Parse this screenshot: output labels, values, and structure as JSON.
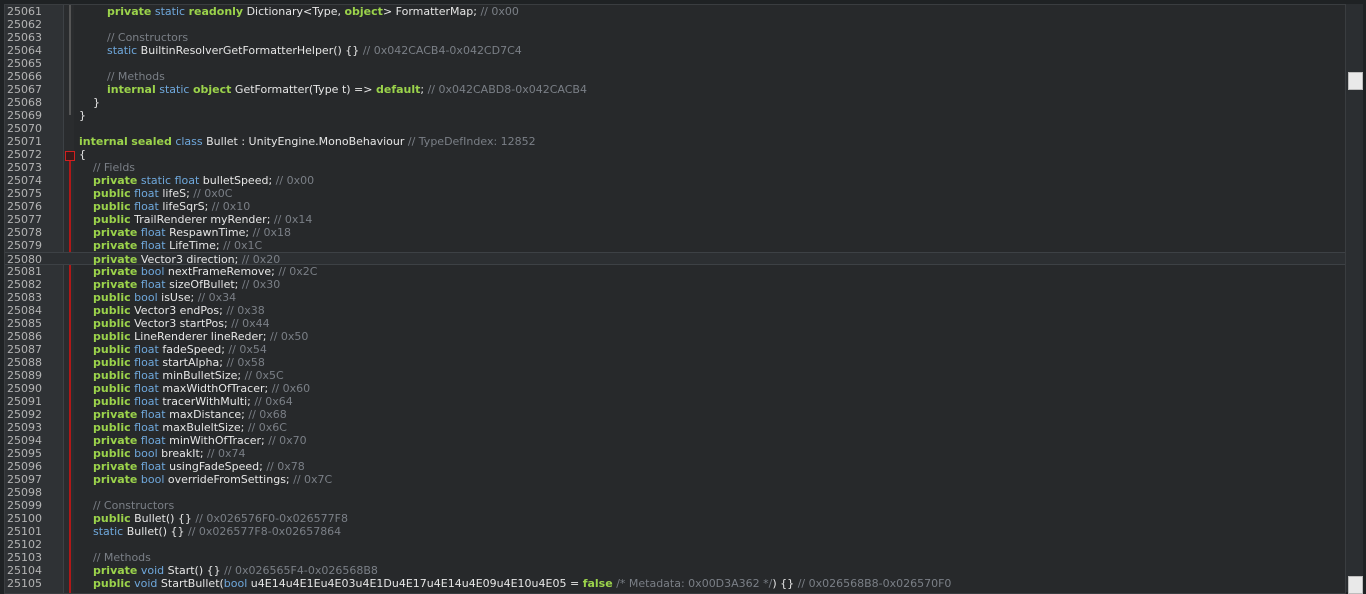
{
  "editor": {
    "lines": [
      {
        "n": "25061",
        "segs": [
          [
            "        ",
            "txt"
          ],
          [
            "private",
            "kw"
          ],
          [
            " ",
            "txt"
          ],
          [
            "static",
            "type"
          ],
          [
            " ",
            "txt"
          ],
          [
            "readonly",
            "kw"
          ],
          [
            " Dictionary<Type, ",
            "txt"
          ],
          [
            "object",
            "kw"
          ],
          [
            "> FormatterMap; ",
            "txt"
          ],
          [
            "// 0x00",
            "cm"
          ]
        ]
      },
      {
        "n": "25062",
        "segs": []
      },
      {
        "n": "25063",
        "segs": [
          [
            "        ",
            "txt"
          ],
          [
            "// Constructors",
            "cm"
          ]
        ]
      },
      {
        "n": "25064",
        "segs": [
          [
            "        ",
            "txt"
          ],
          [
            "static",
            "type"
          ],
          [
            " BuiltinResolverGetFormatterHelper() {} ",
            "txt"
          ],
          [
            "// 0x042CACB4-0x042CD7C4",
            "cm"
          ]
        ]
      },
      {
        "n": "25065",
        "segs": []
      },
      {
        "n": "25066",
        "segs": [
          [
            "        ",
            "txt"
          ],
          [
            "// Methods",
            "cm"
          ]
        ]
      },
      {
        "n": "25067",
        "segs": [
          [
            "        ",
            "txt"
          ],
          [
            "internal",
            "kw"
          ],
          [
            " ",
            "txt"
          ],
          [
            "static",
            "type"
          ],
          [
            " ",
            "txt"
          ],
          [
            "object",
            "kw"
          ],
          [
            " GetFormatter(Type t) => ",
            "txt"
          ],
          [
            "default",
            "kw"
          ],
          [
            "; ",
            "txt"
          ],
          [
            "// 0x042CABD8-0x042CACB4",
            "cm"
          ]
        ]
      },
      {
        "n": "25068",
        "segs": [
          [
            "    }",
            "txt"
          ]
        ]
      },
      {
        "n": "25069",
        "segs": [
          [
            "}",
            "txt"
          ]
        ]
      },
      {
        "n": "25070",
        "segs": []
      },
      {
        "n": "25071",
        "segs": [
          [
            "internal",
            "kw"
          ],
          [
            " ",
            "txt"
          ],
          [
            "sealed",
            "kw"
          ],
          [
            " ",
            "txt"
          ],
          [
            "class",
            "type"
          ],
          [
            " Bullet : UnityEngine.MonoBehaviour ",
            "txt"
          ],
          [
            "// TypeDefIndex: 12852",
            "cm"
          ]
        ]
      },
      {
        "n": "25072",
        "segs": [
          [
            "{",
            "txt"
          ]
        ]
      },
      {
        "n": "25073",
        "segs": [
          [
            "    ",
            "txt"
          ],
          [
            "// Fields",
            "cm"
          ]
        ]
      },
      {
        "n": "25074",
        "segs": [
          [
            "    ",
            "txt"
          ],
          [
            "private",
            "kw"
          ],
          [
            " ",
            "txt"
          ],
          [
            "static",
            "type"
          ],
          [
            " ",
            "txt"
          ],
          [
            "float",
            "type"
          ],
          [
            " bulletSpeed; ",
            "txt"
          ],
          [
            "// 0x00",
            "cm"
          ]
        ]
      },
      {
        "n": "25075",
        "segs": [
          [
            "    ",
            "txt"
          ],
          [
            "public",
            "kw"
          ],
          [
            " ",
            "txt"
          ],
          [
            "float",
            "type"
          ],
          [
            " lifeS; ",
            "txt"
          ],
          [
            "// 0x0C",
            "cm"
          ]
        ]
      },
      {
        "n": "25076",
        "segs": [
          [
            "    ",
            "txt"
          ],
          [
            "public",
            "kw"
          ],
          [
            " ",
            "txt"
          ],
          [
            "float",
            "type"
          ],
          [
            " lifeSqrS; ",
            "txt"
          ],
          [
            "// 0x10",
            "cm"
          ]
        ]
      },
      {
        "n": "25077",
        "segs": [
          [
            "    ",
            "txt"
          ],
          [
            "public",
            "kw"
          ],
          [
            " TrailRenderer myRender; ",
            "txt"
          ],
          [
            "// 0x14",
            "cm"
          ]
        ]
      },
      {
        "n": "25078",
        "segs": [
          [
            "    ",
            "txt"
          ],
          [
            "private",
            "kw"
          ],
          [
            " ",
            "txt"
          ],
          [
            "float",
            "type"
          ],
          [
            " RespawnTime; ",
            "txt"
          ],
          [
            "// 0x18",
            "cm"
          ]
        ]
      },
      {
        "n": "25079",
        "segs": [
          [
            "    ",
            "txt"
          ],
          [
            "private",
            "kw"
          ],
          [
            " ",
            "txt"
          ],
          [
            "float",
            "type"
          ],
          [
            " LifeTime; ",
            "txt"
          ],
          [
            "// 0x1C",
            "cm"
          ]
        ]
      },
      {
        "n": "25080",
        "current": true,
        "segs": [
          [
            "    ",
            "txt"
          ],
          [
            "private",
            "kw"
          ],
          [
            " Vector3 direction; ",
            "txt"
          ],
          [
            "// 0x20",
            "cm"
          ]
        ]
      },
      {
        "n": "25081",
        "segs": [
          [
            "    ",
            "txt"
          ],
          [
            "private",
            "kw"
          ],
          [
            " ",
            "txt"
          ],
          [
            "bool",
            "type"
          ],
          [
            " nextFrameRemove; ",
            "txt"
          ],
          [
            "// 0x2C",
            "cm"
          ]
        ]
      },
      {
        "n": "25082",
        "segs": [
          [
            "    ",
            "txt"
          ],
          [
            "private",
            "kw"
          ],
          [
            " ",
            "txt"
          ],
          [
            "float",
            "type"
          ],
          [
            " sizeOfBullet; ",
            "txt"
          ],
          [
            "// 0x30",
            "cm"
          ]
        ]
      },
      {
        "n": "25083",
        "segs": [
          [
            "    ",
            "txt"
          ],
          [
            "public",
            "kw"
          ],
          [
            " ",
            "txt"
          ],
          [
            "bool",
            "type"
          ],
          [
            " isUse; ",
            "txt"
          ],
          [
            "// 0x34",
            "cm"
          ]
        ]
      },
      {
        "n": "25084",
        "segs": [
          [
            "    ",
            "txt"
          ],
          [
            "public",
            "kw"
          ],
          [
            " Vector3 endPos; ",
            "txt"
          ],
          [
            "// 0x38",
            "cm"
          ]
        ]
      },
      {
        "n": "25085",
        "segs": [
          [
            "    ",
            "txt"
          ],
          [
            "public",
            "kw"
          ],
          [
            " Vector3 startPos; ",
            "txt"
          ],
          [
            "// 0x44",
            "cm"
          ]
        ]
      },
      {
        "n": "25086",
        "segs": [
          [
            "    ",
            "txt"
          ],
          [
            "public",
            "kw"
          ],
          [
            " LineRenderer lineReder; ",
            "txt"
          ],
          [
            "// 0x50",
            "cm"
          ]
        ]
      },
      {
        "n": "25087",
        "segs": [
          [
            "    ",
            "txt"
          ],
          [
            "public",
            "kw"
          ],
          [
            " ",
            "txt"
          ],
          [
            "float",
            "type"
          ],
          [
            " fadeSpeed; ",
            "txt"
          ],
          [
            "// 0x54",
            "cm"
          ]
        ]
      },
      {
        "n": "25088",
        "segs": [
          [
            "    ",
            "txt"
          ],
          [
            "public",
            "kw"
          ],
          [
            " ",
            "txt"
          ],
          [
            "float",
            "type"
          ],
          [
            " startAlpha; ",
            "txt"
          ],
          [
            "// 0x58",
            "cm"
          ]
        ]
      },
      {
        "n": "25089",
        "segs": [
          [
            "    ",
            "txt"
          ],
          [
            "public",
            "kw"
          ],
          [
            " ",
            "txt"
          ],
          [
            "float",
            "type"
          ],
          [
            " minBulletSize; ",
            "txt"
          ],
          [
            "// 0x5C",
            "cm"
          ]
        ]
      },
      {
        "n": "25090",
        "segs": [
          [
            "    ",
            "txt"
          ],
          [
            "public",
            "kw"
          ],
          [
            " ",
            "txt"
          ],
          [
            "float",
            "type"
          ],
          [
            " maxWidthOfTracer; ",
            "txt"
          ],
          [
            "// 0x60",
            "cm"
          ]
        ]
      },
      {
        "n": "25091",
        "segs": [
          [
            "    ",
            "txt"
          ],
          [
            "public",
            "kw"
          ],
          [
            " ",
            "txt"
          ],
          [
            "float",
            "type"
          ],
          [
            " tracerWithMulti; ",
            "txt"
          ],
          [
            "// 0x64",
            "cm"
          ]
        ]
      },
      {
        "n": "25092",
        "segs": [
          [
            "    ",
            "txt"
          ],
          [
            "private",
            "kw"
          ],
          [
            " ",
            "txt"
          ],
          [
            "float",
            "type"
          ],
          [
            " maxDistance; ",
            "txt"
          ],
          [
            "// 0x68",
            "cm"
          ]
        ]
      },
      {
        "n": "25093",
        "segs": [
          [
            "    ",
            "txt"
          ],
          [
            "public",
            "kw"
          ],
          [
            " ",
            "txt"
          ],
          [
            "float",
            "type"
          ],
          [
            " maxBuleltSize; ",
            "txt"
          ],
          [
            "// 0x6C",
            "cm"
          ]
        ]
      },
      {
        "n": "25094",
        "segs": [
          [
            "    ",
            "txt"
          ],
          [
            "private",
            "kw"
          ],
          [
            " ",
            "txt"
          ],
          [
            "float",
            "type"
          ],
          [
            " minWithOfTracer; ",
            "txt"
          ],
          [
            "// 0x70",
            "cm"
          ]
        ]
      },
      {
        "n": "25095",
        "segs": [
          [
            "    ",
            "txt"
          ],
          [
            "public",
            "kw"
          ],
          [
            " ",
            "txt"
          ],
          [
            "bool",
            "type"
          ],
          [
            " breakIt; ",
            "txt"
          ],
          [
            "// 0x74",
            "cm"
          ]
        ]
      },
      {
        "n": "25096",
        "segs": [
          [
            "    ",
            "txt"
          ],
          [
            "private",
            "kw"
          ],
          [
            " ",
            "txt"
          ],
          [
            "float",
            "type"
          ],
          [
            " usingFadeSpeed; ",
            "txt"
          ],
          [
            "// 0x78",
            "cm"
          ]
        ]
      },
      {
        "n": "25097",
        "segs": [
          [
            "    ",
            "txt"
          ],
          [
            "private",
            "kw"
          ],
          [
            " ",
            "txt"
          ],
          [
            "bool",
            "type"
          ],
          [
            " overrideFromSettings; ",
            "txt"
          ],
          [
            "// 0x7C",
            "cm"
          ]
        ]
      },
      {
        "n": "25098",
        "segs": []
      },
      {
        "n": "25099",
        "segs": [
          [
            "    ",
            "txt"
          ],
          [
            "// Constructors",
            "cm"
          ]
        ]
      },
      {
        "n": "25100",
        "segs": [
          [
            "    ",
            "txt"
          ],
          [
            "public",
            "kw"
          ],
          [
            " Bullet() {} ",
            "txt"
          ],
          [
            "// 0x026576F0-0x026577F8",
            "cm"
          ]
        ]
      },
      {
        "n": "25101",
        "segs": [
          [
            "    ",
            "txt"
          ],
          [
            "static",
            "type"
          ],
          [
            " Bullet() {} ",
            "txt"
          ],
          [
            "// 0x026577F8-0x02657864",
            "cm"
          ]
        ]
      },
      {
        "n": "25102",
        "segs": []
      },
      {
        "n": "25103",
        "segs": [
          [
            "    ",
            "txt"
          ],
          [
            "// Methods",
            "cm"
          ]
        ]
      },
      {
        "n": "25104",
        "segs": [
          [
            "    ",
            "txt"
          ],
          [
            "private",
            "kw"
          ],
          [
            " ",
            "txt"
          ],
          [
            "void",
            "type"
          ],
          [
            " Start() {} ",
            "txt"
          ],
          [
            "// 0x026565F4-0x026568B8",
            "cm"
          ]
        ]
      },
      {
        "n": "25105",
        "segs": [
          [
            "    ",
            "txt"
          ],
          [
            "public",
            "kw"
          ],
          [
            " ",
            "txt"
          ],
          [
            "void",
            "type"
          ],
          [
            " StartBullet(",
            "txt"
          ],
          [
            "bool",
            "type"
          ],
          [
            " u4E14u4E1Eu4E03u4E1Du4E17u4E14u4E09u4E10u4E05 = ",
            "txt"
          ],
          [
            "false",
            "kw"
          ],
          [
            " ",
            "txt"
          ],
          [
            "/* Metadata: 0x00D3A362 */",
            "cm"
          ],
          [
            ") {} ",
            "txt"
          ],
          [
            "// 0x026568B8-0x026570F0",
            "cm"
          ]
        ]
      }
    ]
  }
}
